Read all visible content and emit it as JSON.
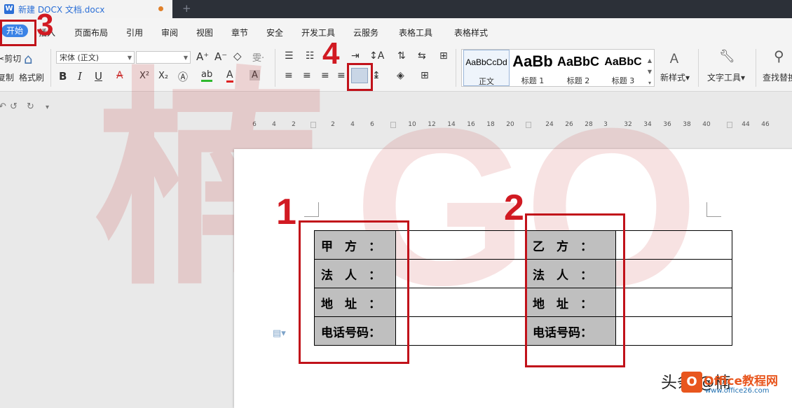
{
  "window": {
    "doc_title": "新建 DOCX 文档.docx",
    "new_tab": "+"
  },
  "menu": {
    "start": "开始",
    "items": [
      "插入",
      "页面布局",
      "引用",
      "审阅",
      "视图",
      "章节",
      "安全",
      "开发工具",
      "云服务",
      "表格工具",
      "表格样式"
    ]
  },
  "ribbon": {
    "cut": "剪切",
    "copy": "复制",
    "format_painter": "格式刷",
    "font_name": "宋体 (正文)",
    "font_size": "",
    "bold": "B",
    "italic": "I",
    "underline": "U",
    "superscript": "X²",
    "subscript": "X₂",
    "styles": [
      {
        "sample": "AaBbCcDd",
        "name": "正文"
      },
      {
        "sample": "AaBb",
        "name": "标题 1"
      },
      {
        "sample": "AaBbC",
        "name": "标题 2"
      },
      {
        "sample": "AaBbC",
        "name": "标题 3"
      }
    ],
    "new_style": "新样式",
    "text_tools": "文字工具",
    "find_replace": "查找替换"
  },
  "ruler": {
    "ticks": [
      "6",
      "4",
      "2",
      "2",
      "4",
      "6",
      "10",
      "12",
      "14",
      "16",
      "18",
      "20",
      "24",
      "26",
      "28",
      "3",
      "32",
      "34",
      "36",
      "38",
      "40",
      "44",
      "46"
    ]
  },
  "table": {
    "party_a": [
      "甲　方　：",
      "法　人　：",
      "地　址　：",
      "电话号码："
    ],
    "party_b": [
      "乙　方　：",
      "法　人　：",
      "地　址　：",
      "电话号码："
    ]
  },
  "annotations": {
    "n1": "1",
    "n2": "2",
    "n3": "3",
    "n4": "4"
  },
  "watermark": {
    "big_char": "楠",
    "big_latin": "GO"
  },
  "brand": {
    "text": "头条 @楠",
    "name": "Office教程网",
    "url": "www.office26.com"
  },
  "colors": {
    "accent": "#3b83e6",
    "annotation_red": "#c1121a",
    "label_cell": "#bfbfbf",
    "titlebar": "#2c3038"
  }
}
